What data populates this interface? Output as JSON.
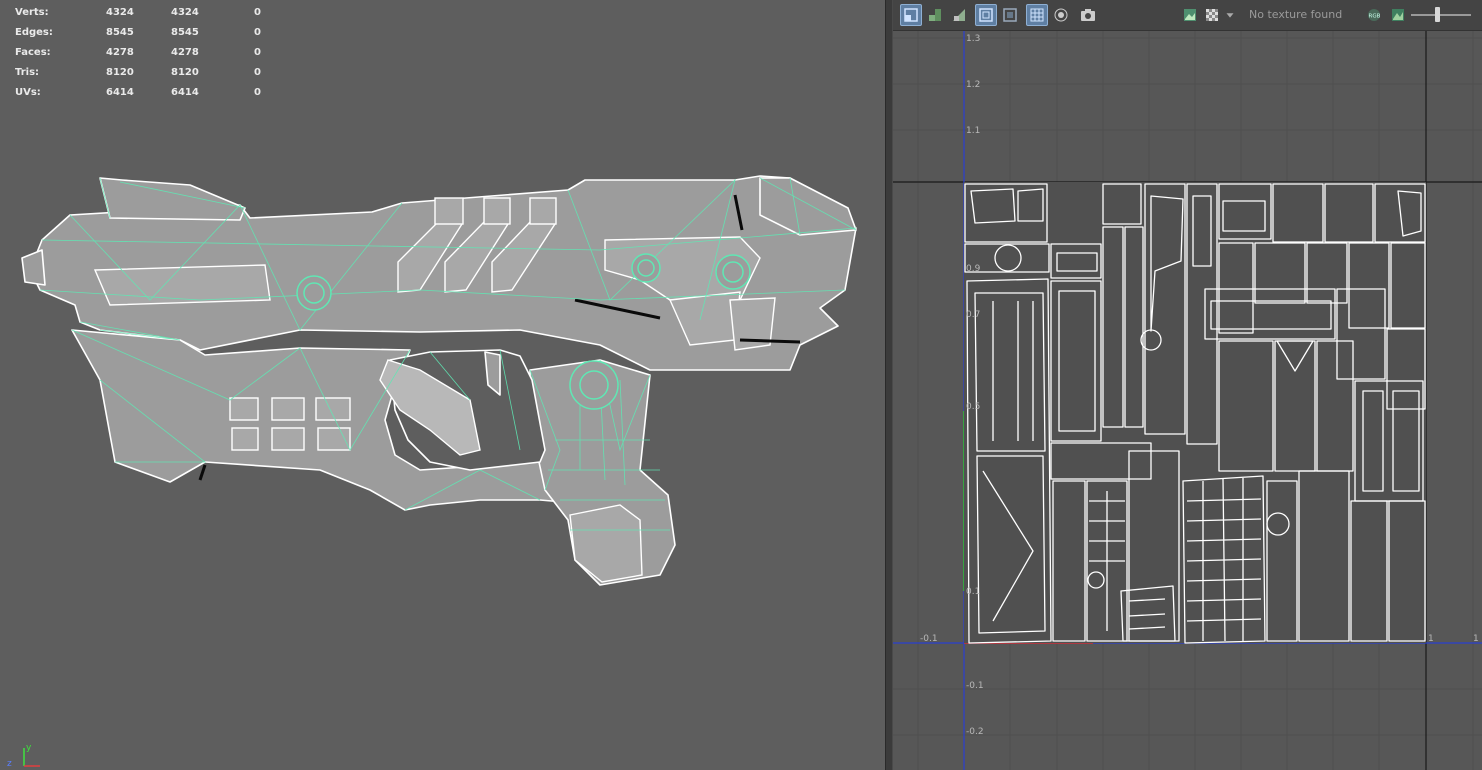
{
  "hud": {
    "rows": [
      {
        "label": "Verts:",
        "v1": "4324",
        "v2": "4324",
        "v3": "0"
      },
      {
        "label": "Edges:",
        "v1": "8545",
        "v2": "8545",
        "v3": "0"
      },
      {
        "label": "Faces:",
        "v1": "4278",
        "v2": "4278",
        "v3": "0"
      },
      {
        "label": "Tris:",
        "v1": "8120",
        "v2": "8120",
        "v3": "0"
      },
      {
        "label": "UVs:",
        "v1": "6414",
        "v2": "6414",
        "v3": "0"
      }
    ]
  },
  "axis_gizmo": {
    "y": "y",
    "z": "z"
  },
  "uv_editor": {
    "texture_status": "No texture found",
    "toolbar_icons": [
      "uv-layout-icon",
      "uv-tile-icon",
      "uv-shade-icon",
      "uv-frame-icon",
      "uv-frame-alt-icon",
      "grid-icon",
      "dot-icon",
      "camera-icon",
      "image-icon",
      "checker-icon",
      "dropdown-arrow-icon",
      "rgb-icon",
      "channel-icon"
    ],
    "axis_labels": {
      "v": [
        "1.3",
        "1.2",
        "1.1",
        "0.9",
        "0.7",
        "0.5",
        "0.1",
        "-0.1",
        "-0.2"
      ],
      "u": [
        "-0.1",
        "1",
        "1"
      ]
    },
    "colors": {
      "mesh_wire": "#5fe8b4",
      "uv_lines": "#ffffff",
      "u_axis": "#2a3fd0",
      "v_axis": "#2a3fd0"
    }
  }
}
